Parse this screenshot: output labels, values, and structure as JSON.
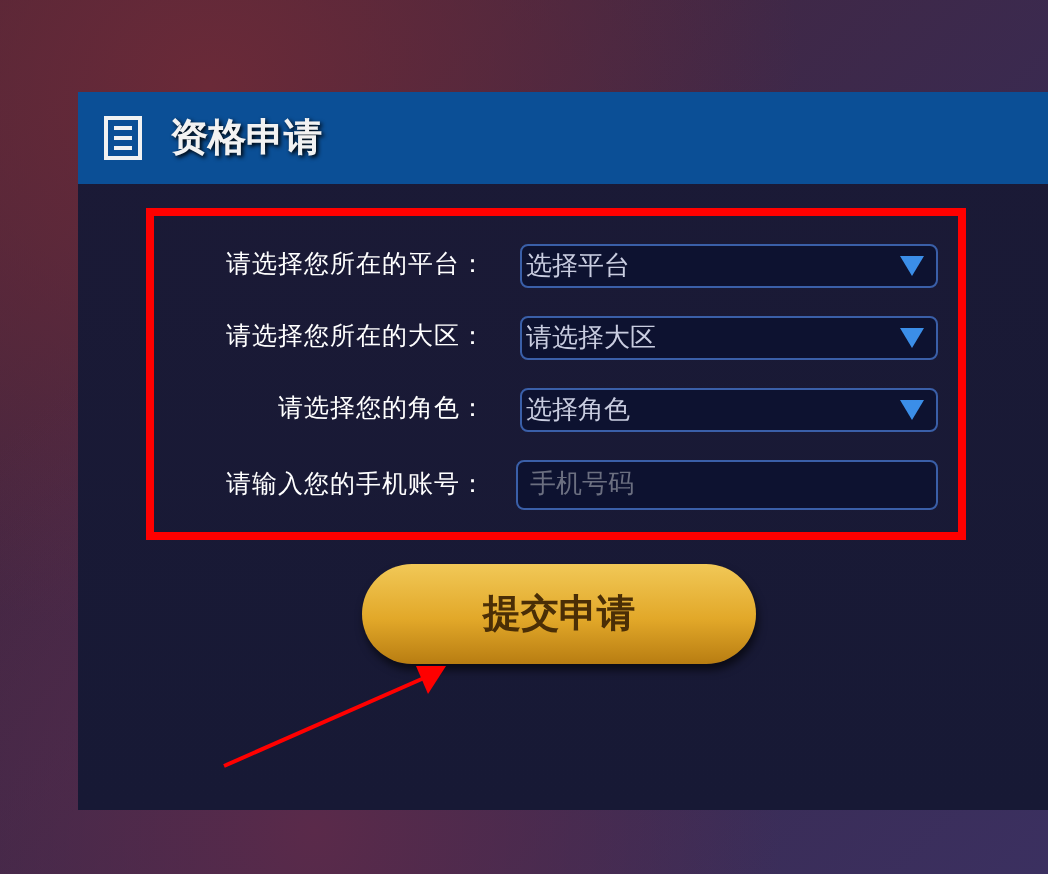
{
  "panel": {
    "title": "资格申请"
  },
  "form": [
    {
      "kind": "select",
      "label": "请选择您所在的平台：",
      "value": "选择平台"
    },
    {
      "kind": "select",
      "label": "请选择您所在的大区：",
      "value": "请选择大区"
    },
    {
      "kind": "select",
      "label": "请选择您的角色：",
      "value": "选择角色"
    },
    {
      "kind": "input",
      "label": "请输入您的手机账号：",
      "placeholder": "手机号码"
    }
  ],
  "submit": {
    "label": "提交申请"
  }
}
